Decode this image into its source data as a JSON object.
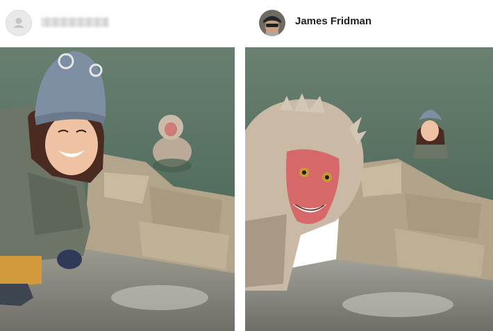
{
  "left_post": {
    "username": "",
    "avatar_icon": "user-placeholder-icon",
    "photo_subject": ""
  },
  "right_post": {
    "username": "James Fridman"
  },
  "colors": {
    "water": "#5f7a6a",
    "stone": "#b7a98e",
    "hat": "#7f8fa3",
    "jacket": "#6c7566",
    "monkey_fur": "#c9b9a5",
    "monkey_face": "#d6686a"
  }
}
